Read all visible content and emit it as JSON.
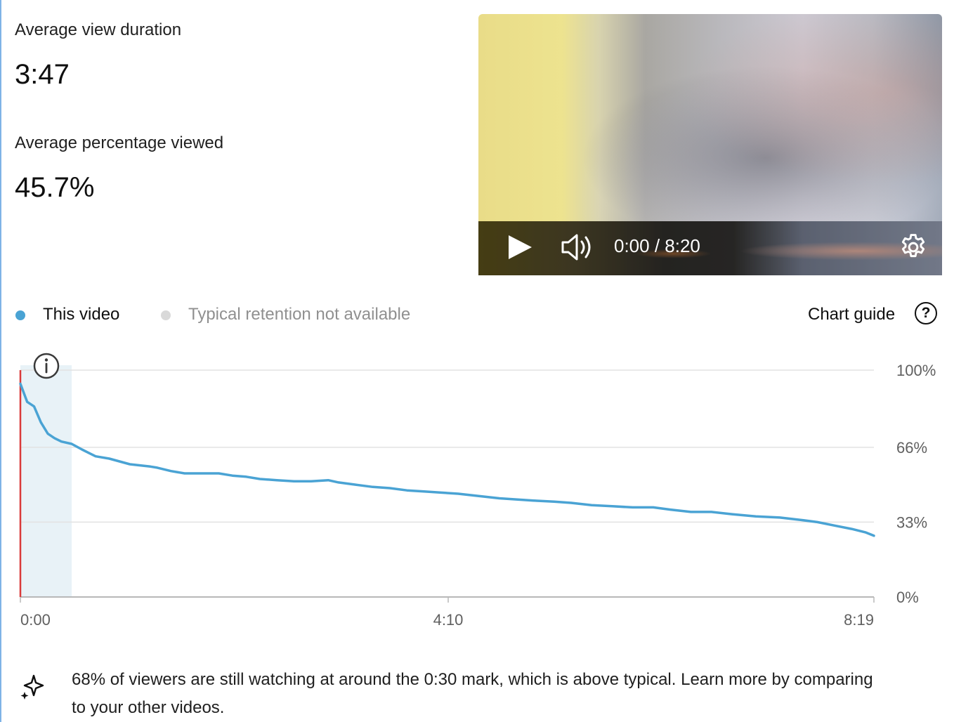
{
  "metrics": {
    "avg_view_duration": {
      "label": "Average view duration",
      "value": "3:47"
    },
    "avg_percentage_viewed": {
      "label": "Average percentage viewed",
      "value": "45.7%"
    }
  },
  "player": {
    "time": "0:00 / 8:20",
    "icons": [
      "play-icon",
      "volume-icon",
      "settings-gear-icon"
    ]
  },
  "legend": {
    "this_video": "This video",
    "typical": "Typical retention not available",
    "chart_guide": "Chart guide",
    "colors": {
      "this_video": "#4aa3d4",
      "typical": "#d9d9d9"
    }
  },
  "chart_data": {
    "type": "line",
    "x_ticks": [
      "0:00",
      "4:10",
      "8:19"
    ],
    "y_ticks": [
      "100%",
      "66%",
      "33%",
      "0%"
    ],
    "xlim_seconds": [
      0,
      499
    ],
    "ylim": [
      0,
      100
    ],
    "grid": true,
    "highlight_region_seconds": [
      0,
      30
    ],
    "series": [
      {
        "name": "This video",
        "color": "#4aa3d4",
        "x_seconds": [
          0,
          4,
          8,
          12,
          16,
          20,
          24,
          30,
          36,
          44,
          52,
          64,
          76,
          80,
          88,
          96,
          106,
          116,
          124,
          132,
          140,
          150,
          160,
          170,
          180,
          186,
          196,
          206,
          216,
          226,
          236,
          246,
          256,
          268,
          280,
          290,
          300,
          312,
          322,
          334,
          346,
          358,
          370,
          380,
          392,
          404,
          416,
          430,
          444,
          456,
          466,
          476,
          486,
          494,
          499
        ],
        "values": [
          94,
          86,
          84,
          77,
          72,
          70,
          68.5,
          67.5,
          65,
          62,
          61,
          58.5,
          57.5,
          57,
          55.5,
          54.5,
          54.5,
          54.5,
          53.5,
          53,
          52,
          51.5,
          51,
          51,
          51.5,
          50.5,
          49.5,
          48.5,
          48,
          47,
          46.5,
          46,
          45.5,
          44.5,
          43.5,
          43,
          42.5,
          42,
          41.5,
          40.5,
          40,
          39.5,
          39.5,
          38.5,
          37.5,
          37.5,
          36.5,
          35.5,
          35,
          34,
          33,
          31.5,
          30,
          28.5,
          27
        ]
      }
    ]
  },
  "insight": {
    "text": "68% of viewers are still watching at around the 0:30 mark, which is above typical. Learn more by comparing to your other videos."
  }
}
